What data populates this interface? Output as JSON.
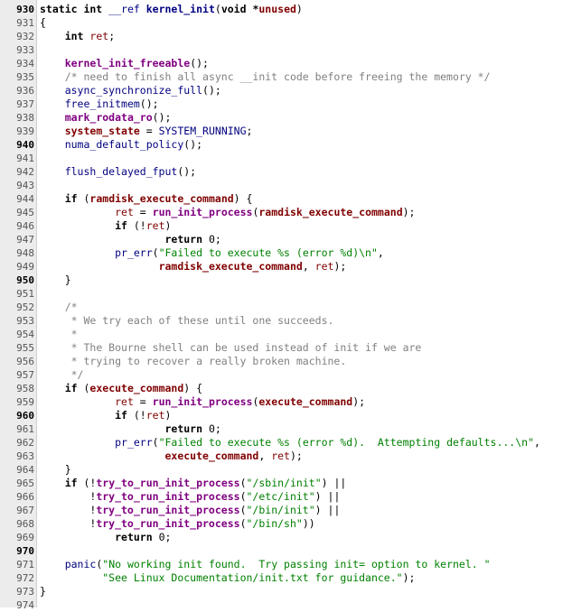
{
  "code": {
    "lines": [
      {
        "n": "930",
        "bold": true,
        "tokens": [
          [
            "static int ",
            "k"
          ],
          [
            "__ref ",
            "i"
          ],
          [
            "kernel_init",
            "fk"
          ],
          [
            "(",
            "p"
          ],
          [
            "void *",
            "k"
          ],
          [
            "unused",
            "vb"
          ],
          [
            ")",
            "p"
          ]
        ]
      },
      {
        "n": "931",
        "bold": false,
        "tokens": [
          [
            "{",
            "p"
          ]
        ]
      },
      {
        "n": "932",
        "bold": false,
        "tokens": [
          [
            "    ",
            "p"
          ],
          [
            "int ",
            "k"
          ],
          [
            "ret",
            "v"
          ],
          [
            ";",
            "p"
          ]
        ]
      },
      {
        "n": "933",
        "bold": false,
        "tokens": []
      },
      {
        "n": "934",
        "bold": false,
        "tokens": [
          [
            "    ",
            "p"
          ],
          [
            "kernel_init_freeable",
            "fb"
          ],
          [
            "();",
            "p"
          ]
        ]
      },
      {
        "n": "935",
        "bold": false,
        "tokens": [
          [
            "    ",
            "p"
          ],
          [
            "/* need to finish all async __init code before freeing the memory */",
            "c"
          ]
        ]
      },
      {
        "n": "936",
        "bold": false,
        "tokens": [
          [
            "    ",
            "p"
          ],
          [
            "async_synchronize_full",
            "f"
          ],
          [
            "();",
            "p"
          ]
        ]
      },
      {
        "n": "937",
        "bold": false,
        "tokens": [
          [
            "    ",
            "p"
          ],
          [
            "free_initmem",
            "f"
          ],
          [
            "();",
            "p"
          ]
        ]
      },
      {
        "n": "938",
        "bold": false,
        "tokens": [
          [
            "    ",
            "p"
          ],
          [
            "mark_rodata_ro",
            "fb"
          ],
          [
            "();",
            "p"
          ]
        ]
      },
      {
        "n": "939",
        "bold": false,
        "tokens": [
          [
            "    ",
            "p"
          ],
          [
            "system_state",
            "vb"
          ],
          [
            " = ",
            "p"
          ],
          [
            "SYSTEM_RUNNING",
            "i"
          ],
          [
            ";",
            "p"
          ]
        ]
      },
      {
        "n": "940",
        "bold": true,
        "tokens": [
          [
            "    ",
            "p"
          ],
          [
            "numa_default_policy",
            "f"
          ],
          [
            "();",
            "p"
          ]
        ]
      },
      {
        "n": "941",
        "bold": false,
        "tokens": []
      },
      {
        "n": "942",
        "bold": false,
        "tokens": [
          [
            "    ",
            "p"
          ],
          [
            "flush_delayed_fput",
            "f"
          ],
          [
            "();",
            "p"
          ]
        ]
      },
      {
        "n": "943",
        "bold": false,
        "tokens": []
      },
      {
        "n": "944",
        "bold": false,
        "tokens": [
          [
            "    ",
            "p"
          ],
          [
            "if ",
            "k"
          ],
          [
            "(",
            "p"
          ],
          [
            "ramdisk_execute_command",
            "vb"
          ],
          [
            ") {",
            "p"
          ]
        ]
      },
      {
        "n": "945",
        "bold": false,
        "tokens": [
          [
            "            ",
            "p"
          ],
          [
            "ret",
            "v"
          ],
          [
            " = ",
            "p"
          ],
          [
            "run_init_process",
            "fb"
          ],
          [
            "(",
            "p"
          ],
          [
            "ramdisk_execute_command",
            "vb"
          ],
          [
            ");",
            "p"
          ]
        ]
      },
      {
        "n": "946",
        "bold": false,
        "tokens": [
          [
            "            ",
            "p"
          ],
          [
            "if ",
            "k"
          ],
          [
            "(!",
            "p"
          ],
          [
            "ret",
            "v"
          ],
          [
            ")",
            "p"
          ]
        ]
      },
      {
        "n": "947",
        "bold": false,
        "tokens": [
          [
            "                    ",
            "p"
          ],
          [
            "return ",
            "k"
          ],
          [
            "0;",
            "p"
          ]
        ]
      },
      {
        "n": "948",
        "bold": false,
        "tokens": [
          [
            "            ",
            "p"
          ],
          [
            "pr_err",
            "f"
          ],
          [
            "(",
            "p"
          ],
          [
            "\"Failed to execute %s (error %d)\\n\"",
            "s"
          ],
          [
            ",",
            "p"
          ]
        ]
      },
      {
        "n": "949",
        "bold": false,
        "tokens": [
          [
            "                   ",
            "p"
          ],
          [
            "ramdisk_execute_command",
            "vb"
          ],
          [
            ", ",
            "p"
          ],
          [
            "ret",
            "v"
          ],
          [
            ");",
            "p"
          ]
        ]
      },
      {
        "n": "950",
        "bold": true,
        "tokens": [
          [
            "    ",
            "p"
          ],
          [
            "}",
            "p"
          ]
        ]
      },
      {
        "n": "951",
        "bold": false,
        "tokens": []
      },
      {
        "n": "952",
        "bold": false,
        "tokens": [
          [
            "    ",
            "p"
          ],
          [
            "/*",
            "c"
          ]
        ]
      },
      {
        "n": "953",
        "bold": false,
        "tokens": [
          [
            "     ",
            "p"
          ],
          [
            "* We try each of these until one succeeds.",
            "c"
          ]
        ]
      },
      {
        "n": "954",
        "bold": false,
        "tokens": [
          [
            "     ",
            "p"
          ],
          [
            "*",
            "c"
          ]
        ]
      },
      {
        "n": "955",
        "bold": false,
        "tokens": [
          [
            "     ",
            "p"
          ],
          [
            "* The Bourne shell can be used instead of init if we are",
            "c"
          ]
        ]
      },
      {
        "n": "956",
        "bold": false,
        "tokens": [
          [
            "     ",
            "p"
          ],
          [
            "* trying to recover a really broken machine.",
            "c"
          ]
        ]
      },
      {
        "n": "957",
        "bold": false,
        "tokens": [
          [
            "     ",
            "p"
          ],
          [
            "*/",
            "c"
          ]
        ]
      },
      {
        "n": "958",
        "bold": false,
        "tokens": [
          [
            "    ",
            "p"
          ],
          [
            "if ",
            "k"
          ],
          [
            "(",
            "p"
          ],
          [
            "execute_command",
            "vb"
          ],
          [
            ") {",
            "p"
          ]
        ]
      },
      {
        "n": "959",
        "bold": false,
        "tokens": [
          [
            "            ",
            "p"
          ],
          [
            "ret",
            "v"
          ],
          [
            " = ",
            "p"
          ],
          [
            "run_init_process",
            "fb"
          ],
          [
            "(",
            "p"
          ],
          [
            "execute_command",
            "vb"
          ],
          [
            ");",
            "p"
          ]
        ]
      },
      {
        "n": "960",
        "bold": true,
        "tokens": [
          [
            "            ",
            "p"
          ],
          [
            "if ",
            "k"
          ],
          [
            "(!",
            "p"
          ],
          [
            "ret",
            "v"
          ],
          [
            ")",
            "p"
          ]
        ]
      },
      {
        "n": "961",
        "bold": false,
        "tokens": [
          [
            "                    ",
            "p"
          ],
          [
            "return ",
            "k"
          ],
          [
            "0;",
            "p"
          ]
        ]
      },
      {
        "n": "962",
        "bold": false,
        "tokens": [
          [
            "            ",
            "p"
          ],
          [
            "pr_err",
            "f"
          ],
          [
            "(",
            "p"
          ],
          [
            "\"Failed to execute %s (error %d).  Attempting defaults...\\n\"",
            "s"
          ],
          [
            ",",
            "p"
          ]
        ]
      },
      {
        "n": "963",
        "bold": false,
        "tokens": [
          [
            "                    ",
            "p"
          ],
          [
            "execute_command",
            "vb"
          ],
          [
            ", ",
            "p"
          ],
          [
            "ret",
            "v"
          ],
          [
            ");",
            "p"
          ]
        ]
      },
      {
        "n": "964",
        "bold": false,
        "tokens": [
          [
            "    ",
            "p"
          ],
          [
            "}",
            "p"
          ]
        ]
      },
      {
        "n": "965",
        "bold": false,
        "tokens": [
          [
            "    ",
            "p"
          ],
          [
            "if ",
            "k"
          ],
          [
            "(!",
            "p"
          ],
          [
            "try_to_run_init_process",
            "fb"
          ],
          [
            "(",
            "p"
          ],
          [
            "\"/sbin/init\"",
            "s"
          ],
          [
            ") ||",
            "p"
          ]
        ]
      },
      {
        "n": "966",
        "bold": false,
        "tokens": [
          [
            "        !",
            "p"
          ],
          [
            "try_to_run_init_process",
            "fb"
          ],
          [
            "(",
            "p"
          ],
          [
            "\"/etc/init\"",
            "s"
          ],
          [
            ") ||",
            "p"
          ]
        ]
      },
      {
        "n": "967",
        "bold": false,
        "tokens": [
          [
            "        !",
            "p"
          ],
          [
            "try_to_run_init_process",
            "fb"
          ],
          [
            "(",
            "p"
          ],
          [
            "\"/bin/init\"",
            "s"
          ],
          [
            ") ||",
            "p"
          ]
        ]
      },
      {
        "n": "968",
        "bold": false,
        "tokens": [
          [
            "        !",
            "p"
          ],
          [
            "try_to_run_init_process",
            "fb"
          ],
          [
            "(",
            "p"
          ],
          [
            "\"/bin/sh\"",
            "s"
          ],
          [
            "))",
            "p"
          ]
        ]
      },
      {
        "n": "969",
        "bold": false,
        "tokens": [
          [
            "            ",
            "p"
          ],
          [
            "return ",
            "k"
          ],
          [
            "0;",
            "p"
          ]
        ]
      },
      {
        "n": "970",
        "bold": true,
        "tokens": []
      },
      {
        "n": "971",
        "bold": false,
        "tokens": [
          [
            "    ",
            "p"
          ],
          [
            "panic",
            "f"
          ],
          [
            "(",
            "p"
          ],
          [
            "\"No working init found.  Try passing init= option to kernel. \"",
            "s"
          ]
        ]
      },
      {
        "n": "972",
        "bold": false,
        "tokens": [
          [
            "          ",
            "p"
          ],
          [
            "\"See Linux Documentation/init.txt for guidance.\"",
            "s"
          ],
          [
            ");",
            "p"
          ]
        ]
      },
      {
        "n": "973",
        "bold": false,
        "tokens": [
          [
            "}",
            "p"
          ]
        ]
      },
      {
        "n": "974",
        "bold": false,
        "tokens": []
      }
    ]
  },
  "colors": {
    "gutter_bg": "#ececec",
    "keyword": "#000000",
    "function": "#000080",
    "function_bold": "#800080",
    "variable": "#800000",
    "string": "#008000",
    "comment": "#808080"
  }
}
